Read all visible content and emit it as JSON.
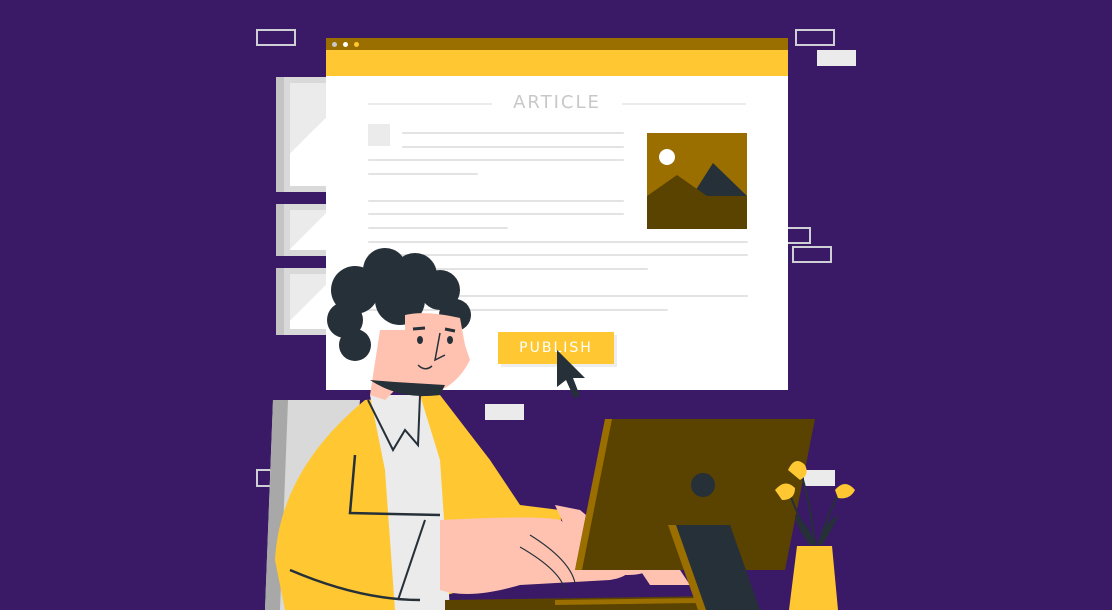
{
  "scene": {
    "description": "Illustration of a person at a computer publishing an article",
    "colors": {
      "background": "#3a1a66",
      "accent_yellow": "#ffc832",
      "dark_gold": "#9a6f00",
      "brown": "#5a4200",
      "dark_slate": "#263038",
      "skin": "#ffc2b0",
      "light_gray": "#ebebeb"
    }
  },
  "browser": {
    "window_dots": [
      "gray-dot",
      "white-dot",
      "yellow-dot"
    ],
    "article_title": "ARTICLE",
    "image_placeholder_icon": "landscape-image-icon",
    "publish_button_label": "PUBLISH",
    "cursor_icon": "mouse-pointer-icon"
  },
  "decor": {
    "monitor_icon": "desktop-monitor-icon",
    "plant_icon": "flower-vase-icon"
  }
}
